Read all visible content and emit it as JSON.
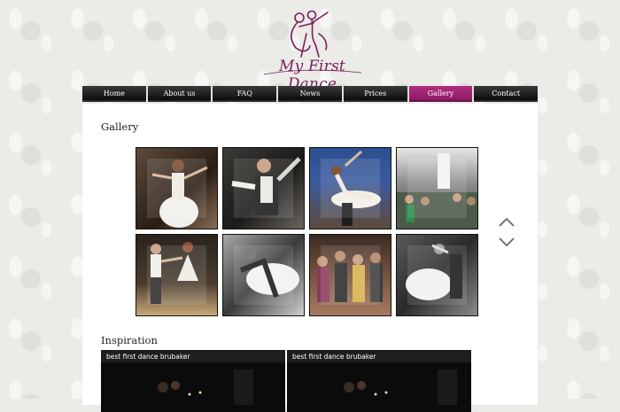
{
  "brand": {
    "logo_text": "My First Dance",
    "accent": "#8c1a64"
  },
  "nav": {
    "items": [
      {
        "label": "Home"
      },
      {
        "label": "About us"
      },
      {
        "label": "FAQ"
      },
      {
        "label": "News"
      },
      {
        "label": "Prices"
      },
      {
        "label": "Gallery",
        "active": true
      },
      {
        "label": "Contact"
      }
    ]
  },
  "gallery": {
    "heading": "Gallery",
    "thumbnails": [
      {
        "subject": "bride-spinning"
      },
      {
        "subject": "groom-dancing"
      },
      {
        "subject": "lift-move"
      },
      {
        "subject": "guests-watching"
      },
      {
        "subject": "couple-dancing"
      },
      {
        "subject": "couple-black-white"
      },
      {
        "subject": "crowd-dancing"
      },
      {
        "subject": "bride-dip"
      }
    ],
    "scroll_up_icon": "chevron-up-icon",
    "scroll_down_icon": "chevron-down-icon"
  },
  "inspiration": {
    "heading": "Inspiration",
    "videos": [
      {
        "title": "best first dance brubaker"
      },
      {
        "title": "best first dance brubaker"
      }
    ]
  }
}
